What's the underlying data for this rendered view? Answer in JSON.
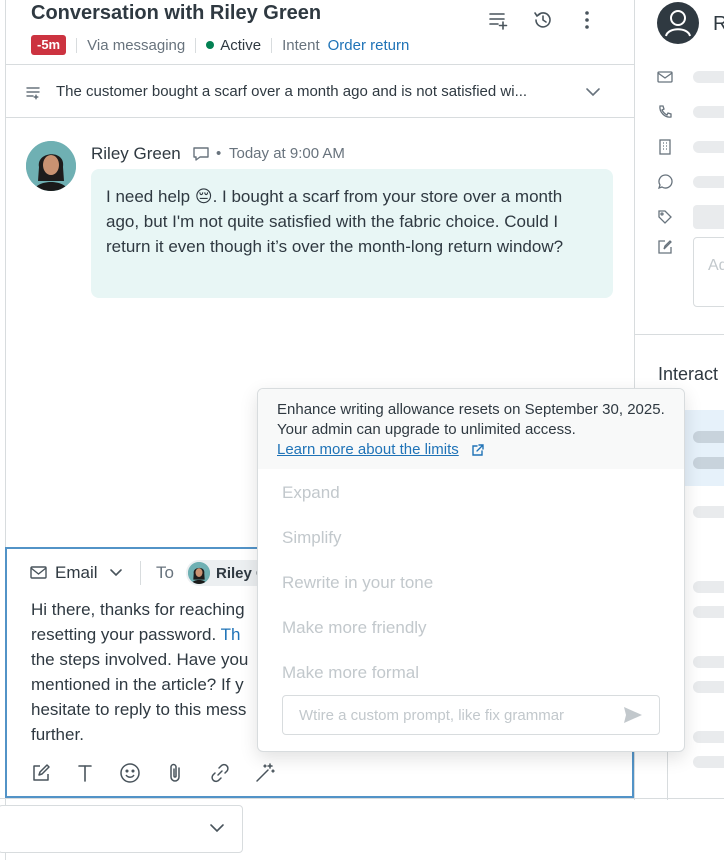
{
  "header": {
    "title": "Conversation with Riley Green",
    "sla_badge": "-5m",
    "channel": "Via messaging",
    "status": "Active",
    "intent_label": "Intent",
    "intent_value": "Order return",
    "icons": [
      "ticket-list-add-icon",
      "history-icon",
      "more-vertical-icon"
    ],
    "status_color": "#038153",
    "badge_color": "#cc3340"
  },
  "summary": {
    "text": "The customer bought a scarf over a month ago and is not satisfied wi..."
  },
  "message": {
    "author": "Riley Green",
    "time": "Today at 9:00 AM",
    "body": "I need help 😔. I bought a scarf from your store over a month ago, but I'm not quite satisfied with the fabric choice. Could I return it even though it’s over the month-long return window?"
  },
  "composer": {
    "channel": "Email",
    "to_label": "To",
    "recipient": "Riley G",
    "reply_lines": [
      "Hi there, thanks for reaching",
      "resetting your password. Th",
      "the steps involved. Have you",
      "mentioned in the article? If y",
      "hesitate to reply to this mess",
      "further."
    ],
    "tools": [
      "compose-icon",
      "text-format-icon",
      "emoji-icon",
      "attachment-icon",
      "link-icon",
      "magic-wand-icon"
    ]
  },
  "sidebar": {
    "user_name": "R",
    "note_placeholder": "Ad",
    "interactions_label": "Interact"
  },
  "popup": {
    "notice": "Enhance writing allowance resets on September 30, 2025. Your admin can upgrade to unlimited access.",
    "notice_link": "Learn more about the limits",
    "options": [
      "Expand",
      "Simplify",
      "Rewrite in your tone",
      "Make more friendly",
      "Make more formal"
    ],
    "prompt_placeholder": "Wtire a custom prompt, like fix grammar"
  }
}
